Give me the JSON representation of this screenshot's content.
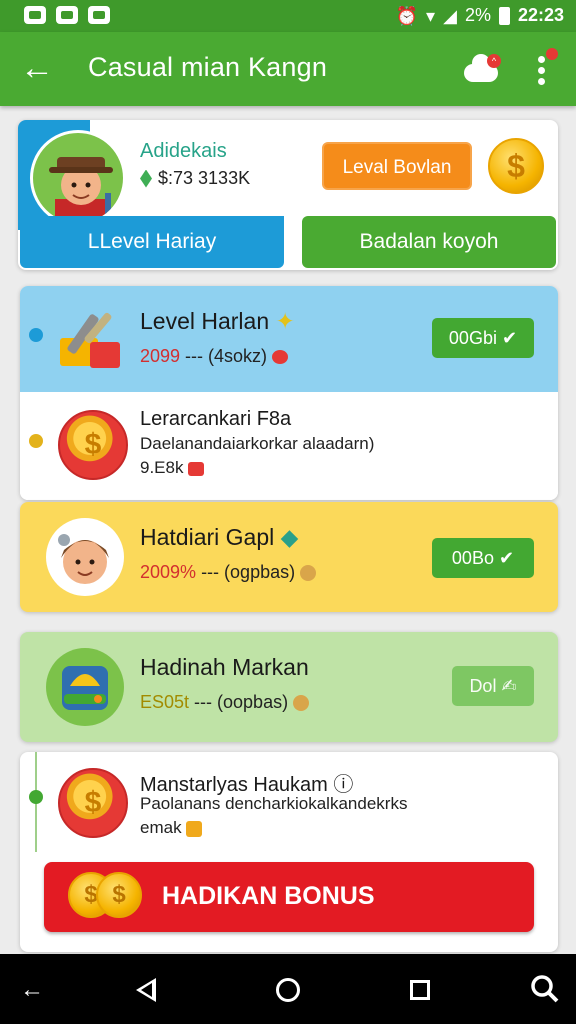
{
  "status_bar": {
    "battery_percent": "2%",
    "time": "22:23"
  },
  "app_bar": {
    "title": "Casual mian Kangn"
  },
  "profile": {
    "username": "Adidekais",
    "balance": "$:73 3133K",
    "level_button": "Leval Bovlan",
    "level_harian_button": "LLevel Hariay",
    "badge_button": "Badalan koyoh"
  },
  "tasks": [
    {
      "title": "Level Harlan",
      "highlight": "2099",
      "subtitle": " --- (4sokz)",
      "button": "00Gbi"
    },
    {
      "title": "Lerarcankari F8a",
      "desc": "Daelanandaiarkorkar alaadarn)",
      "amount": "9.E8k"
    },
    {
      "title": "Hatdiari Gapl",
      "highlight": "2009%",
      "subtitle": " --- (ogpbas)",
      "button": "00Bo"
    },
    {
      "title": "Hadinah Markan",
      "highlight": "ES05t",
      "subtitle": " --- (oopbas)",
      "button": "Dol"
    },
    {
      "title": "Manstarlyas Haukam",
      "desc": "Paolanans dencharkiokalkandekrks",
      "amount": "emak"
    }
  ],
  "bonus_button": "HADIKAN BONUS",
  "colors": {
    "primary_green": "#4aaa32",
    "blue": "#1d9bd7",
    "red": "#e31b23",
    "orange": "#f58c1a"
  }
}
